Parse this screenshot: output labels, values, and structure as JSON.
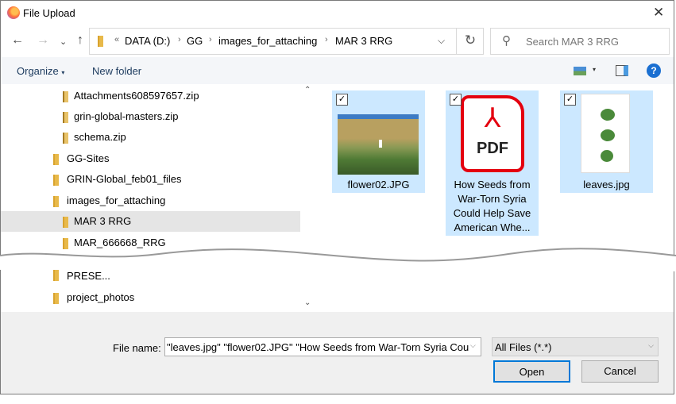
{
  "window": {
    "title": "File Upload"
  },
  "address": {
    "crumbs": [
      "DATA (D:)",
      "GG",
      "images_for_attaching",
      "MAR 3 RRG"
    ],
    "search_placeholder": "Search MAR 3 RRG"
  },
  "toolbar": {
    "organize": "Organize",
    "new_folder": "New folder",
    "help": "?"
  },
  "tree": [
    {
      "label": "Attachments608597657.zip",
      "type": "zip",
      "level": 2
    },
    {
      "label": "grin-global-masters.zip",
      "type": "zip",
      "level": 2
    },
    {
      "label": "schema.zip",
      "type": "zip",
      "level": 2
    },
    {
      "label": "GG-Sites",
      "type": "folder",
      "level": 1
    },
    {
      "label": "GRIN-Global_feb01_files",
      "type": "folder",
      "level": 1
    },
    {
      "label": "images_for_attaching",
      "type": "folder",
      "level": 1
    },
    {
      "label": "MAR 3 RRG",
      "type": "folder",
      "level": 2,
      "selected": true
    },
    {
      "label": "MAR_666668_RRG",
      "type": "folder",
      "level": 2
    },
    {
      "label": "PRESE...",
      "type": "folder",
      "level": 1
    },
    {
      "label": "project_photos",
      "type": "folder",
      "level": 1
    }
  ],
  "files": [
    {
      "name": "flower02.JPG",
      "checked": true
    },
    {
      "name": "How Seeds from War-Torn Syria Could Help Save American Whe...",
      "checked": true,
      "icon_text": "PDF"
    },
    {
      "name": "leaves.jpg",
      "checked": true
    }
  ],
  "footer": {
    "file_name_label": "File name:",
    "file_name_value": "\"leaves.jpg\" \"flower02.JPG\" \"How Seeds from War-Torn Syria Cou",
    "filter": "All Files (*.*)",
    "open": "Open",
    "cancel": "Cancel"
  },
  "colors": {
    "selection": "#cce8ff",
    "accent": "#0078d7",
    "pdf_red": "#e4000f"
  }
}
